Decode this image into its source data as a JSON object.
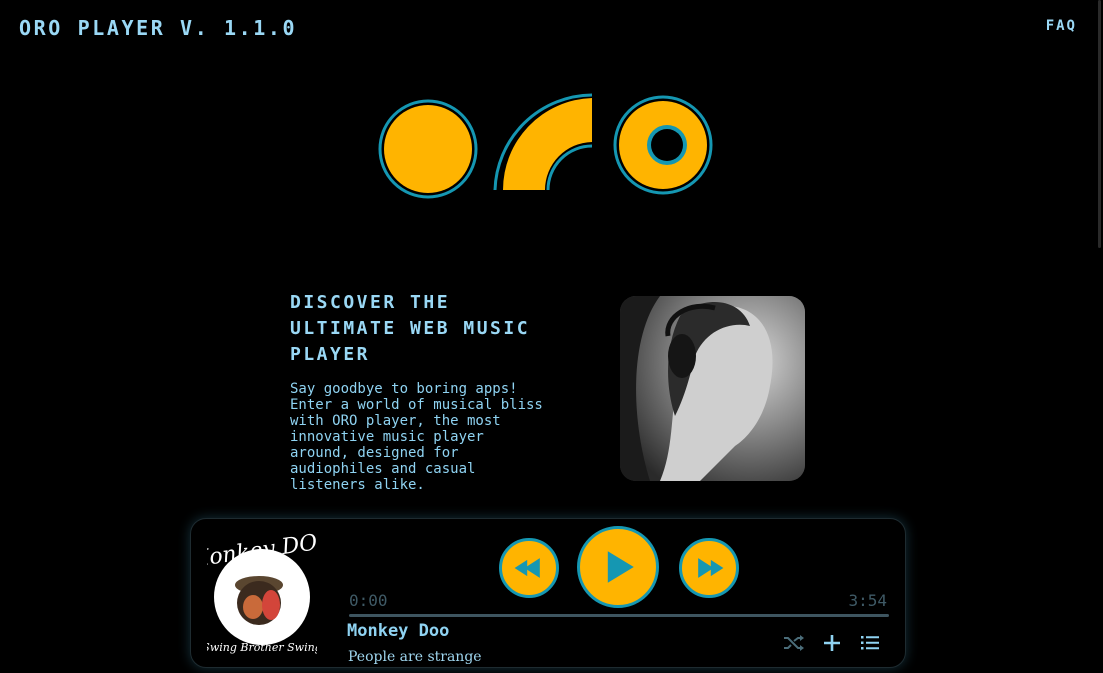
{
  "header": {
    "brand": "ORO PLAYER V. 1.1.0",
    "faq_label": "FAQ"
  },
  "colors": {
    "background": "#000000",
    "text": "#8fd3f2",
    "accent_yellow": "#ffb400",
    "accent_teal": "#1597b2"
  },
  "hero": {
    "title": "Discover the Ultimate Web Music Player",
    "text": "Say goodbye to boring apps! Enter a world of musical bliss with ORO player, the most innovative music player around, designed for audiophiles and casual listeners alike."
  },
  "player": {
    "album_icon": "album-cover-monkey-doo",
    "album_art_text": "Monkey DOO",
    "album_art_subtext": "Swing Brother Swing",
    "current_time": "0:00",
    "total_time": "3:54",
    "progress": 0,
    "track_title": "Monkey Doo",
    "track_artist": "People are strange",
    "icons": {
      "prev": "rewind-icon",
      "play": "play-icon",
      "next": "fast-forward-icon",
      "shuffle": "shuffle-icon",
      "add": "plus-icon",
      "playlist": "playlist-icon"
    }
  }
}
